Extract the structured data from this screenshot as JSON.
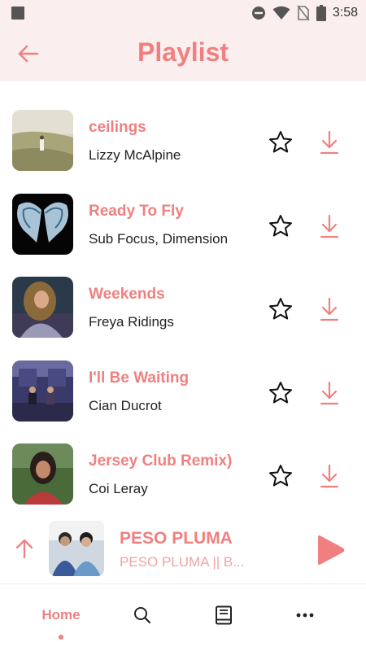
{
  "status_bar": {
    "time": "3:58",
    "icons": [
      "notification-square-icon",
      "dnd-icon",
      "wifi-icon",
      "no-sim-icon",
      "battery-icon"
    ]
  },
  "header": {
    "title": "Playlist",
    "back_icon": "arrow-left-icon"
  },
  "playlist": [
    {
      "title": "ceilings",
      "artist": "Lizzy McAlpine"
    },
    {
      "title": "Ready To Fly",
      "artist": "Sub Focus, Dimension"
    },
    {
      "title": "Weekends",
      "artist": "Freya Ridings"
    },
    {
      "title": "I'll Be Waiting",
      "artist": "Cian Ducrot"
    },
    {
      "title": "Jersey Club Remix)",
      "artist": "Coi Leray"
    }
  ],
  "now_playing": {
    "title": "PESO PLUMA",
    "subtitle": "PESO PLUMA || B..."
  },
  "bottom_nav": {
    "home_label": "Home",
    "items": [
      "home",
      "search-icon",
      "book-icon",
      "more-icon"
    ]
  },
  "colors": {
    "accent": "#f08080",
    "header_bg": "#fbeeee"
  }
}
